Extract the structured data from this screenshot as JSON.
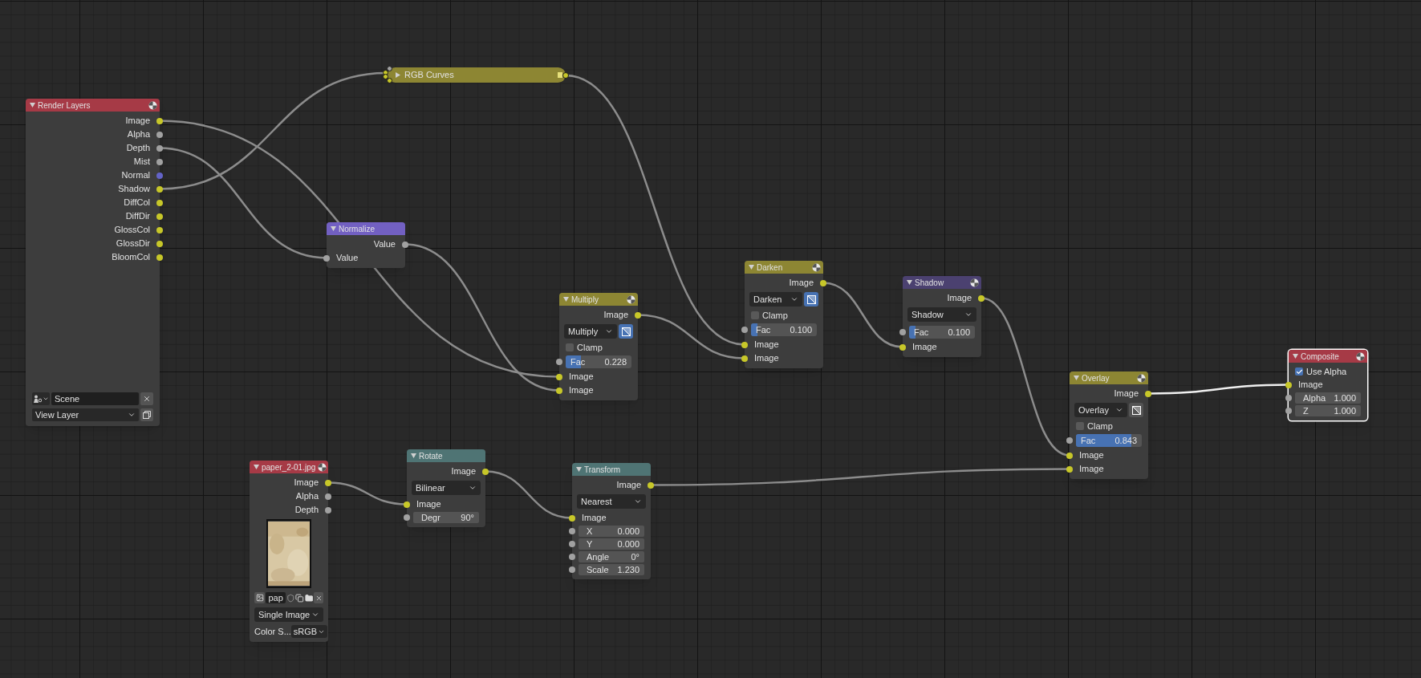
{
  "nodes": [
    {
      "title": "Render Layers",
      "color": "#a63a46",
      "collapsed": false,
      "preview_icon": true,
      "selected": false,
      "rows": [
        {
          "kind": "output",
          "label": "Image",
          "color": "#c7c729"
        },
        {
          "kind": "output",
          "label": "Alpha",
          "color": "#a1a1a1"
        },
        {
          "kind": "output",
          "label": "Depth",
          "color": "#a1a1a1"
        },
        {
          "kind": "output",
          "label": "Mist",
          "color": "#a1a1a1"
        },
        {
          "kind": "output",
          "label": "Normal",
          "color": "#6363c7"
        },
        {
          "kind": "output",
          "label": "Shadow",
          "color": "#c7c729"
        },
        {
          "kind": "output",
          "label": "DiffCol",
          "color": "#c7c729"
        },
        {
          "kind": "output",
          "label": "DiffDir",
          "color": "#c7c729"
        },
        {
          "kind": "output",
          "label": "GlossCol",
          "color": "#c7c729"
        },
        {
          "kind": "output",
          "label": "GlossDir",
          "color": "#c7c729"
        },
        {
          "kind": "output",
          "label": "BloomCol",
          "color": "#c7c729"
        },
        {
          "kind": "scene",
          "value": "Scene"
        },
        {
          "kind": "view_layer",
          "value": "View Layer"
        }
      ]
    },
    {
      "title": "RGB Curves",
      "color": "#8d8633",
      "collapsed": true,
      "selected": false
    },
    {
      "title": "Normalize",
      "color": "#7260c2",
      "collapsed": false,
      "preview_icon": false,
      "selected": false,
      "rows": [
        {
          "kind": "output",
          "label": "Value",
          "color": "#a1a1a1"
        },
        {
          "kind": "input",
          "label": "Value",
          "color": "#a1a1a1"
        }
      ]
    },
    {
      "title": "Multiply",
      "color": "#8d8633",
      "collapsed": false,
      "preview_icon": true,
      "selected": false,
      "rows": [
        {
          "kind": "output",
          "label": "Image",
          "color": "#c7c729"
        },
        {
          "kind": "dropdown",
          "value": "Multiply",
          "toggle": {
            "on": true
          }
        },
        {
          "kind": "checkbox",
          "label": "Clamp",
          "checked": false
        },
        {
          "kind": "slider",
          "label": "Fac",
          "value": "0.228",
          "level": 0.228,
          "color": "#a1a1a1"
        },
        {
          "kind": "input",
          "label": "Image",
          "color": "#c7c729"
        },
        {
          "kind": "input",
          "label": "Image",
          "color": "#c7c729"
        }
      ]
    },
    {
      "title": "Darken",
      "color": "#8d8633",
      "collapsed": false,
      "preview_icon": true,
      "selected": false,
      "rows": [
        {
          "kind": "output",
          "label": "Image",
          "color": "#c7c729"
        },
        {
          "kind": "dropdown",
          "value": "Darken",
          "toggle": {
            "on": true
          }
        },
        {
          "kind": "checkbox",
          "label": "Clamp",
          "checked": false
        },
        {
          "kind": "slider",
          "label": "Fac",
          "value": "0.100",
          "level": 0.1,
          "color": "#a1a1a1"
        },
        {
          "kind": "input",
          "label": "Image",
          "color": "#c7c729"
        },
        {
          "kind": "input",
          "label": "Image",
          "color": "#c7c729"
        }
      ]
    },
    {
      "title": "Shadow",
      "color": "#4b4170",
      "collapsed": false,
      "preview_icon": true,
      "selected": false,
      "rows": [
        {
          "kind": "output",
          "label": "Image",
          "color": "#c7c729"
        },
        {
          "kind": "dropdown",
          "value": "Shadow"
        },
        {
          "kind": "slider",
          "label": "Fac",
          "value": "0.100",
          "level": 0.1,
          "color": "#a1a1a1"
        },
        {
          "kind": "input",
          "label": "Image",
          "color": "#c7c729"
        }
      ]
    },
    {
      "title": "Overlay",
      "color": "#8d8633",
      "collapsed": false,
      "preview_icon": true,
      "selected": false,
      "rows": [
        {
          "kind": "output",
          "label": "Image",
          "color": "#c7c729"
        },
        {
          "kind": "dropdown",
          "value": "Overlay",
          "toggle": {
            "on": false
          }
        },
        {
          "kind": "checkbox",
          "label": "Clamp",
          "checked": false
        },
        {
          "kind": "slider",
          "label": "Fac",
          "value": "0.843",
          "level": 0.843,
          "color": "#a1a1a1"
        },
        {
          "kind": "input",
          "label": "Image",
          "color": "#c7c729"
        },
        {
          "kind": "input",
          "label": "Image",
          "color": "#c7c729"
        }
      ]
    },
    {
      "title": "Composite",
      "color": "#a63a46",
      "collapsed": false,
      "preview_icon": true,
      "selected": true,
      "rows": [
        {
          "kind": "checkbox",
          "label": "Use Alpha",
          "checked": true
        },
        {
          "kind": "input",
          "label": "Image",
          "color": "#c7c729"
        },
        {
          "kind": "field",
          "label": "Alpha",
          "value": "1.000",
          "color": "#a1a1a1"
        },
        {
          "kind": "field",
          "label": "Z",
          "value": "1.000",
          "color": "#a1a1a1"
        }
      ]
    },
    {
      "title": "paper_2-01.jpg",
      "color": "#a63a46",
      "collapsed": false,
      "preview_icon": true,
      "selected": false,
      "rows": [
        {
          "kind": "output",
          "label": "Image",
          "color": "#c7c729"
        },
        {
          "kind": "output",
          "label": "Alpha",
          "color": "#a1a1a1"
        },
        {
          "kind": "output",
          "label": "Depth",
          "color": "#a1a1a1"
        },
        {
          "kind": "preview"
        },
        {
          "kind": "file",
          "value": "pap"
        },
        {
          "kind": "dropdown",
          "value": "Single Image"
        },
        {
          "kind": "labeled_dropdown",
          "label": "Color S...",
          "value": "sRGB"
        }
      ]
    },
    {
      "title": "Rotate",
      "color": "#4f7474",
      "collapsed": false,
      "preview_icon": false,
      "selected": false,
      "rows": [
        {
          "kind": "output",
          "label": "Image",
          "color": "#c7c729"
        },
        {
          "kind": "dropdown",
          "value": "Bilinear"
        },
        {
          "kind": "input",
          "label": "Image",
          "color": "#c7c729"
        },
        {
          "kind": "field",
          "label": "Degr",
          "value": "90°",
          "color": "#a1a1a1"
        }
      ]
    },
    {
      "title": "Transform",
      "color": "#4f7474",
      "collapsed": false,
      "preview_icon": false,
      "selected": false,
      "rows": [
        {
          "kind": "output",
          "label": "Image",
          "color": "#c7c729"
        },
        {
          "kind": "dropdown",
          "value": "Nearest"
        },
        {
          "kind": "input",
          "label": "Image",
          "color": "#c7c729"
        },
        {
          "kind": "field",
          "label": "X",
          "value": "0.000",
          "color": "#a1a1a1"
        },
        {
          "kind": "field",
          "label": "Y",
          "value": "0.000",
          "color": "#a1a1a1"
        },
        {
          "kind": "field",
          "label": "Angle",
          "value": "0°",
          "color": "#a1a1a1"
        },
        {
          "kind": "field",
          "label": "Scale",
          "value": "1.230",
          "color": "#a1a1a1"
        }
      ]
    }
  ]
}
